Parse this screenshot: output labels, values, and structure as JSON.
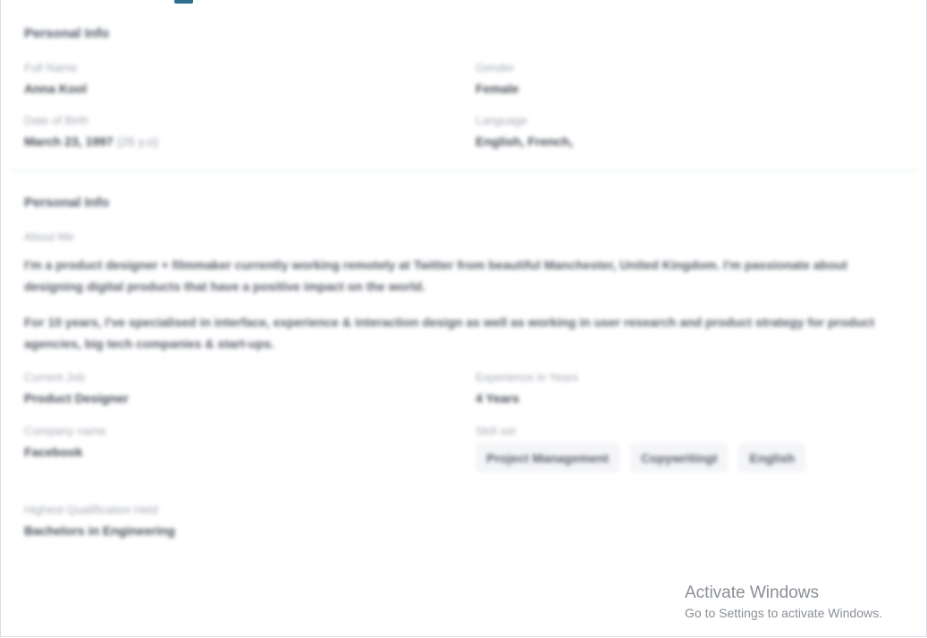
{
  "personal_info": {
    "title": "Personal Info",
    "fields": {
      "full_name_label": "Full Name",
      "full_name_value": "Anna Kool",
      "gender_label": "Gender",
      "gender_value": "Female",
      "dob_label": "Date of Birth",
      "dob_value": "March 23, 1997",
      "dob_age": "(26 y.o)",
      "language_label": "Language",
      "language_value": "English, French,"
    }
  },
  "about_section": {
    "title": "Personal Info",
    "about_label": "About Me",
    "about_paragraphs": [
      "I'm a product designer + filmmaker currently working remotely at Twitter from beautiful Manchester, United Kingdom. I'm passionate about designing digital products that have a positive impact on the world.",
      "For 10 years, I've specialised in interface, experience & interaction design as well as working in user research and product strategy for product agencies, big tech companies & start-ups."
    ],
    "current_job_label": "Current Job",
    "current_job_value": "Product Designer",
    "experience_label": "Experience in Years",
    "experience_value": "4 Years",
    "company_label": "Company name",
    "company_value": "Facebook",
    "skill_label": "Skill set",
    "skills": [
      "Project Management",
      "Copywritingt",
      "English"
    ],
    "qualification_label": "Highest Qualification Held",
    "qualification_value": "Bachelors in Engineering"
  },
  "watermark": {
    "title": "Activate Windows",
    "subtitle": "Go to Settings to activate Windows."
  },
  "colors": {
    "tab_indicator": "#2f6f8f",
    "divider": "#e8f4f2",
    "chip_bg": "#f4f5f8"
  }
}
